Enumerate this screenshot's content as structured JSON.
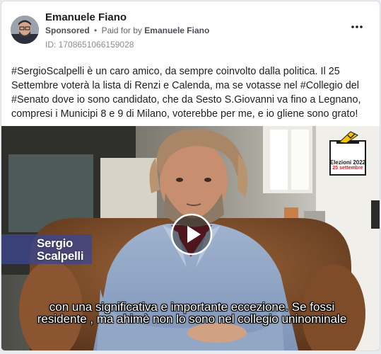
{
  "post": {
    "author": "Emanuele Fiano",
    "sponsored": "Sponsored",
    "separator": "•",
    "paid_for_prefix": "Paid for by",
    "paid_for_name": "Emanuele Fiano",
    "id_line": "ID: 1708651066159028",
    "text": "#SergioScalpelli è un caro amico, da sempre coinvolto dalla politica. Il 25 Settembre voterà la lista di Renzi e Calenda, ma se votasse nel #Collegio del #Senato dove io sono candidato, che da Sesto S.Giovanni va fino a Legnano, compresi i Municipi 8 e 9 di Milano, voterebbe per me, e io gliene sono grato!"
  },
  "video": {
    "name_line1": "Sergio",
    "name_line2": "Scalpelli",
    "badge_line1": "Elezioni 2022",
    "badge_line2": "25 settembre",
    "subtitle_line1": "con una significativa e importante eccezione. Se fossi",
    "subtitle_line2": "residente , ma ahimè non lo sono nel collegio uninominale"
  },
  "icons": {
    "more": "more-horizontal-icon",
    "play": "play-icon",
    "ballot": "ballot-box-icon"
  },
  "colors": {
    "name_tag": "#3c468c",
    "badge_date": "#d2242a",
    "ballot_paper": "#f5c400"
  }
}
